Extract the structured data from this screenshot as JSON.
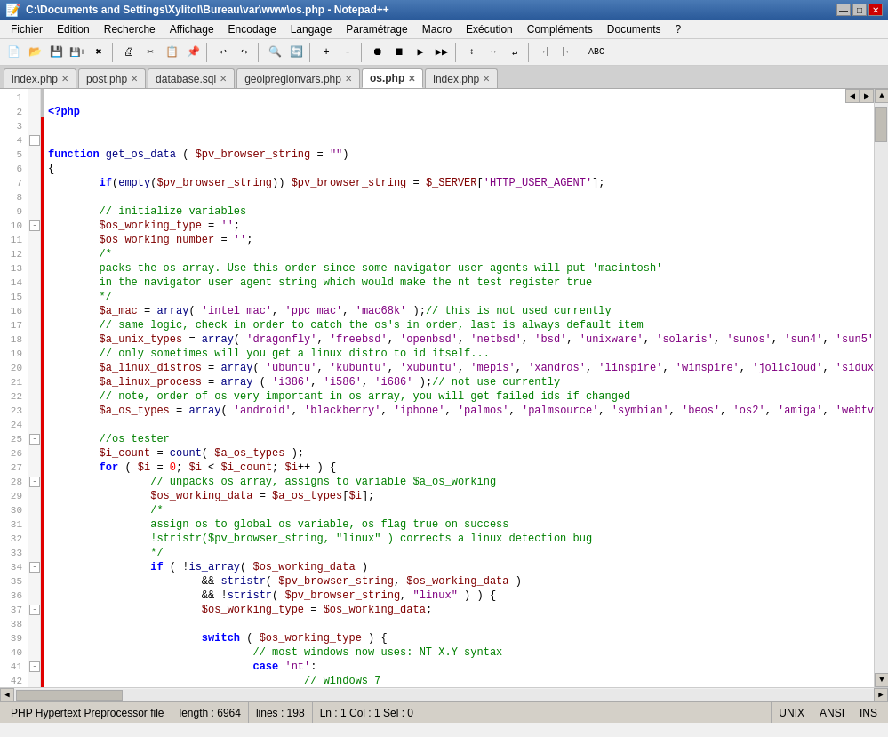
{
  "titlebar": {
    "title": "C:\\Documents and Settings\\Xylitol\\Bureau\\var\\www\\os.php - Notepad++",
    "minimize": "—",
    "maximize": "□",
    "close": "✕"
  },
  "menubar": {
    "items": [
      "Fichier",
      "Edition",
      "Recherche",
      "Affichage",
      "Encodage",
      "Langage",
      "Paramétrage",
      "Macro",
      "Exécution",
      "Compléments",
      "Documents",
      "?"
    ]
  },
  "tabs": [
    {
      "label": "index.php",
      "active": false
    },
    {
      "label": "post.php",
      "active": false
    },
    {
      "label": "database.sql",
      "active": false
    },
    {
      "label": "geoipregionvars.php",
      "active": false
    },
    {
      "label": "os.php",
      "active": true
    },
    {
      "label": "index.php",
      "active": false
    }
  ],
  "statusbar": {
    "filetype": "PHP Hypertext Preprocessor file",
    "length": "length : 6964",
    "lines": "lines : 198",
    "position": "Ln : 1   Col : 1   Sel : 0",
    "dos": "UNIX",
    "encoding": "ANSI",
    "ins": "INS"
  }
}
